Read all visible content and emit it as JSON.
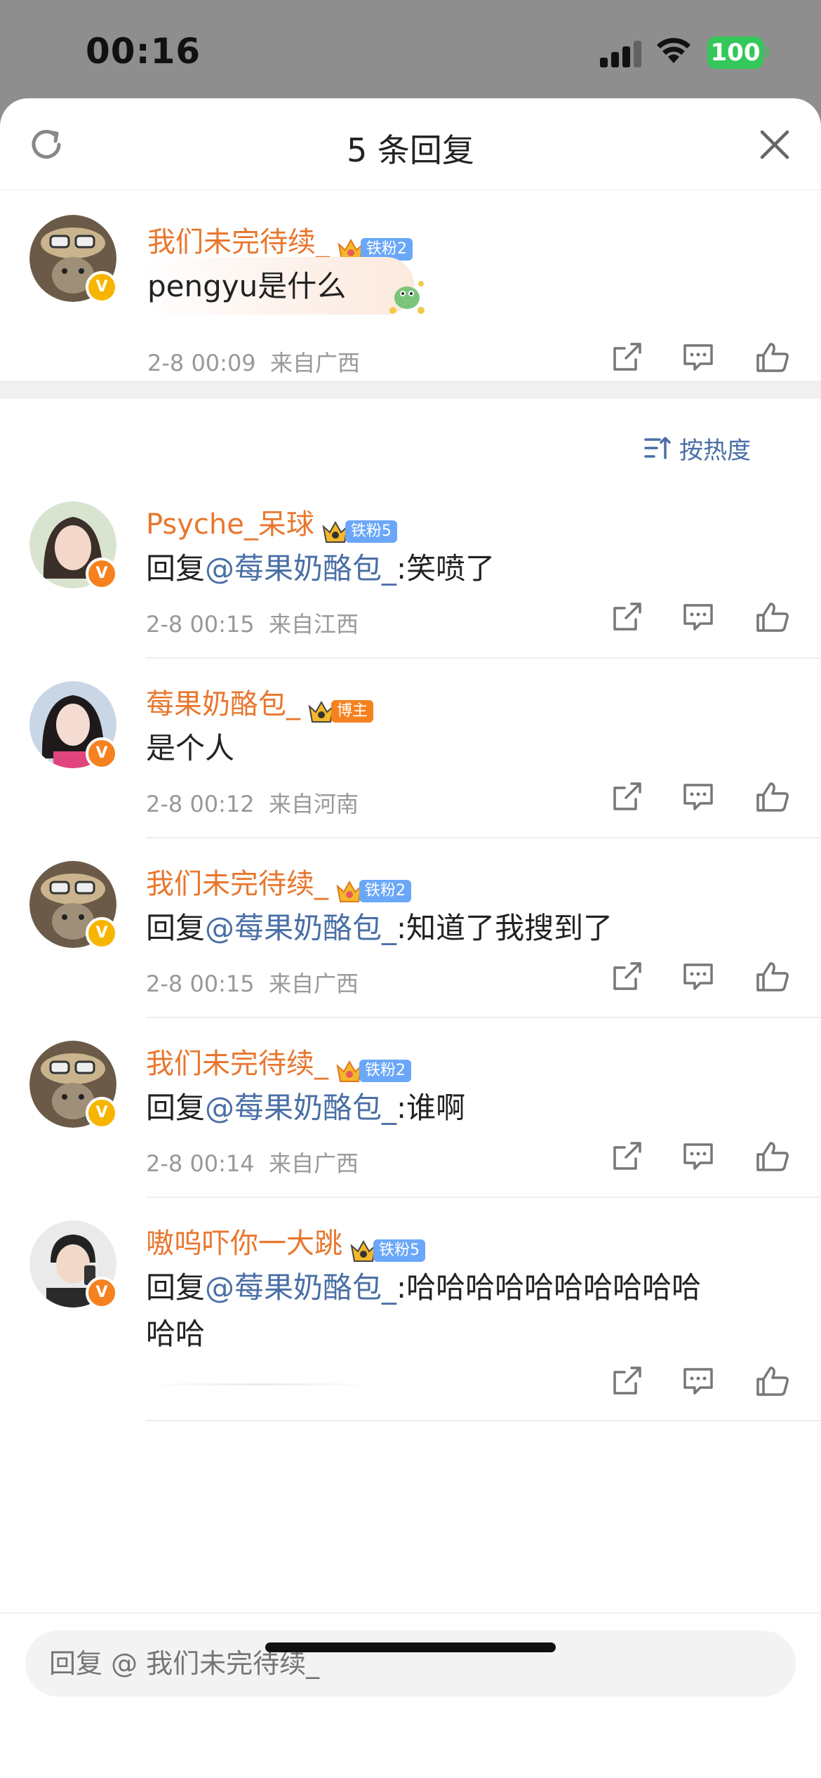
{
  "status": {
    "time": "00:16",
    "battery": "100"
  },
  "header": {
    "title": "5 条回复"
  },
  "original": {
    "user": "我们未完待续_",
    "fan_tag": "铁粉2",
    "text": "pengyu是什么",
    "date": "2-8 00:09",
    "location": "来自广西"
  },
  "sort": {
    "label": "按热度"
  },
  "replies": [
    {
      "user": "Psyche_呆球",
      "fan_tag": "铁粉5",
      "reply_prefix": "回复",
      "mention": "@莓果奶酪包_",
      "text": ":笑喷了",
      "date": "2-8 00:15",
      "location": "来自江西"
    },
    {
      "user": "莓果奶酪包_",
      "fan_tag": "博主",
      "text": "是个人",
      "date": "2-8 00:12",
      "location": "来自河南"
    },
    {
      "user": "我们未完待续_",
      "fan_tag": "铁粉2",
      "reply_prefix": "回复",
      "mention": "@莓果奶酪包_",
      "text": ":知道了我搜到了",
      "date": "2-8 00:15",
      "location": "来自广西"
    },
    {
      "user": "我们未完待续_",
      "fan_tag": "铁粉2",
      "reply_prefix": "回复",
      "mention": "@莓果奶酪包_",
      "text": ":谁啊",
      "date": "2-8 00:14",
      "location": "来自广西"
    },
    {
      "user": "嗷呜吓你一大跳",
      "fan_tag": "铁粉5",
      "reply_prefix": "回复",
      "mention": "@莓果奶酪包_",
      "text": ":哈哈哈哈哈哈哈哈哈哈",
      "text2": "哈哈"
    }
  ],
  "input": {
    "placeholder": "回复 @ 我们未完待续_"
  },
  "icons": {
    "share": "share-icon",
    "comment": "comment-icon",
    "like": "like-icon",
    "refresh": "refresh-icon",
    "close": "close-icon",
    "sort": "sort-icon"
  },
  "colors": {
    "username": "#e8772e",
    "mention": "#4a6fa5",
    "fan_blue": "#6aa7f8",
    "fan_orange": "#f5811f"
  }
}
